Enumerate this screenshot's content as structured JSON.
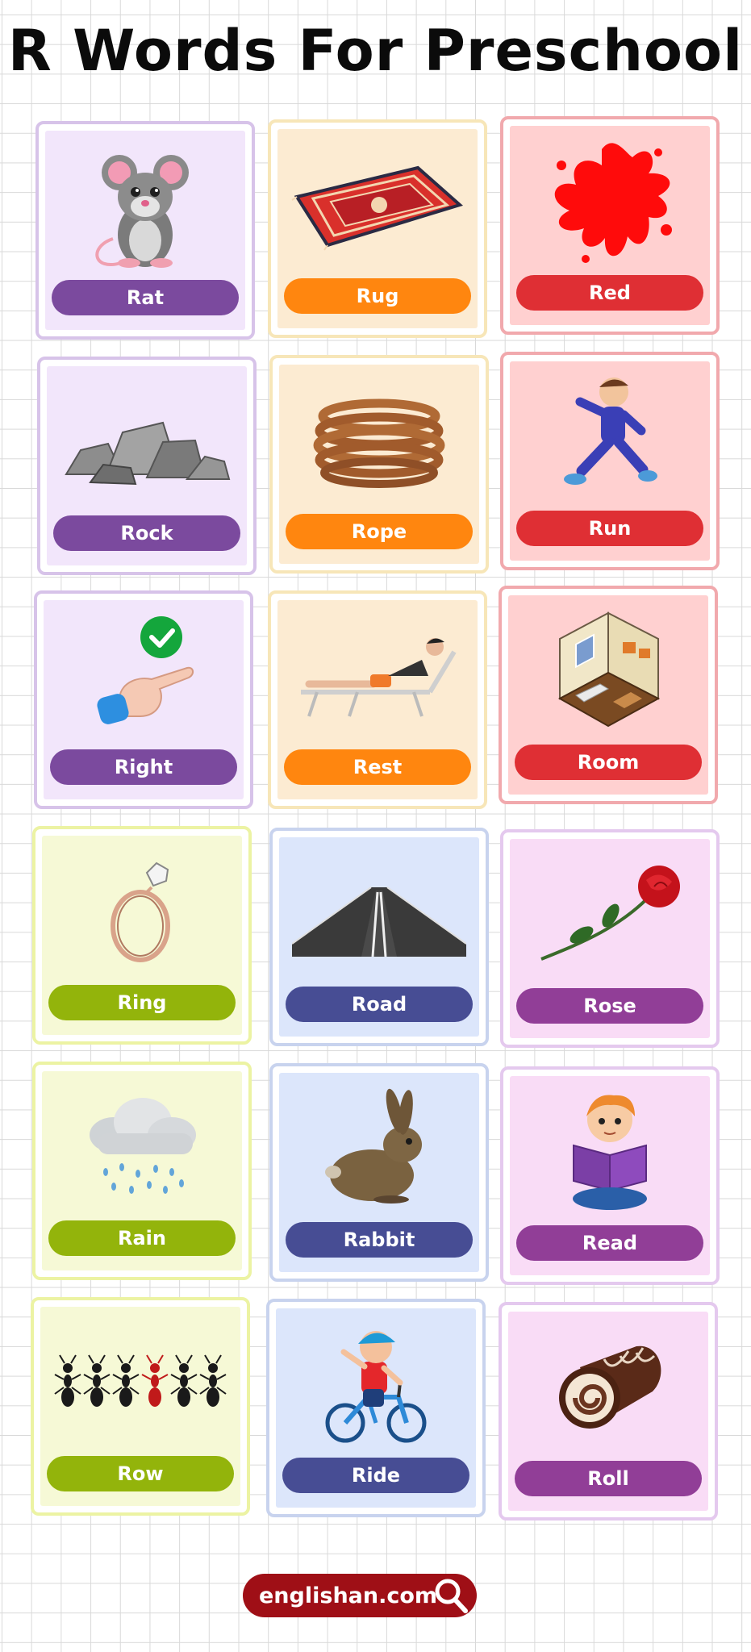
{
  "title": "R Words For Preschool",
  "cards": [
    {
      "word": "Rat",
      "icon": "rat-icon"
    },
    {
      "word": "Rug",
      "icon": "rug-icon"
    },
    {
      "word": "Red",
      "icon": "red-splat-icon"
    },
    {
      "word": "Rock",
      "icon": "rock-icon"
    },
    {
      "word": "Rope",
      "icon": "rope-icon"
    },
    {
      "word": "Run",
      "icon": "running-boy-icon"
    },
    {
      "word": "Right",
      "icon": "right-hand-check-icon"
    },
    {
      "word": "Rest",
      "icon": "resting-man-icon"
    },
    {
      "word": "Room",
      "icon": "room-icon"
    },
    {
      "word": "Ring",
      "icon": "ring-icon"
    },
    {
      "word": "Road",
      "icon": "road-icon"
    },
    {
      "word": "Rose",
      "icon": "rose-icon"
    },
    {
      "word": "Rain",
      "icon": "rain-cloud-icon"
    },
    {
      "word": "Rabbit",
      "icon": "rabbit-icon"
    },
    {
      "word": "Read",
      "icon": "reading-boy-icon"
    },
    {
      "word": "Row",
      "icon": "ants-row-icon"
    },
    {
      "word": "Ride",
      "icon": "bike-ride-icon"
    },
    {
      "word": "Roll",
      "icon": "cake-roll-icon"
    }
  ],
  "footer": {
    "site": "englishan.com",
    "icon": "search-icon"
  },
  "colors": {
    "purple": "#7b4a9e",
    "orange": "#ff860f",
    "red": "#df2f34",
    "green": "#93b40b",
    "blue": "#474d94",
    "pink": "#913e97",
    "footer_bg": "#9f0f16"
  }
}
